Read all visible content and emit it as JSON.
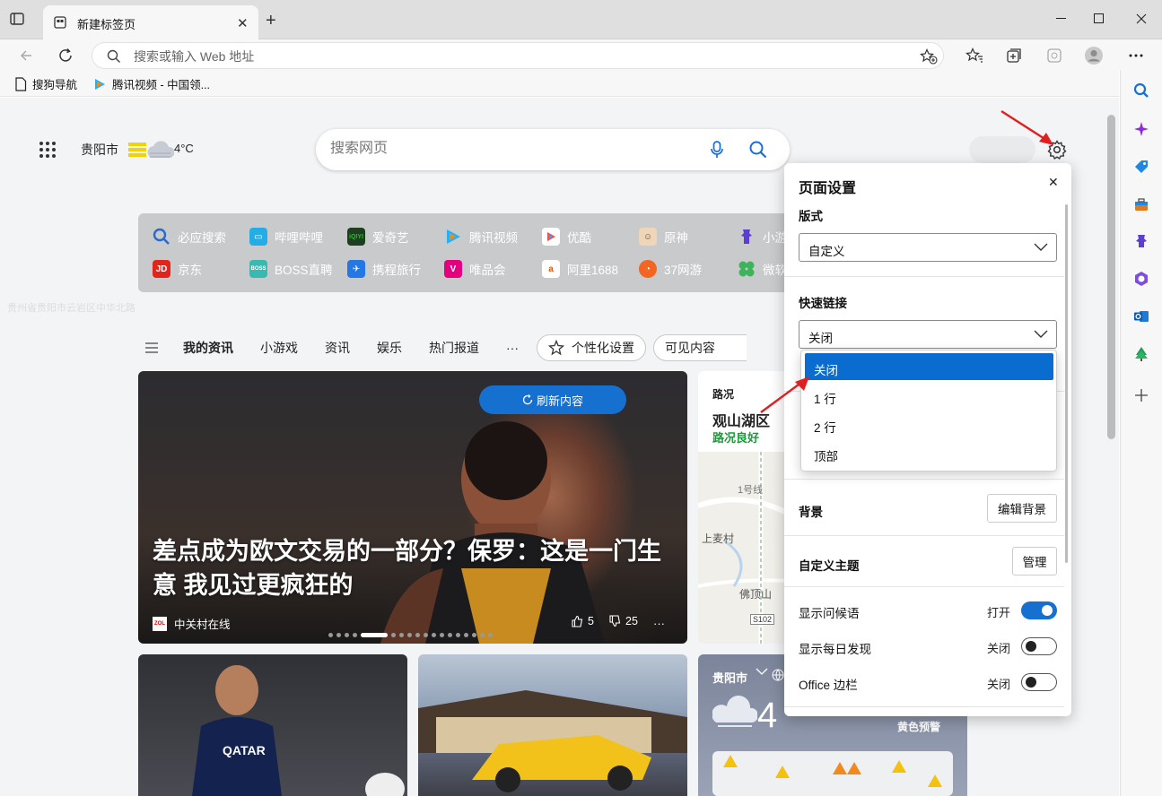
{
  "browser": {
    "tab_title": "新建标签页",
    "address_placeholder": "搜索或输入 Web 地址",
    "favorites": [
      {
        "label": "搜狗导航",
        "icon": "page-icon"
      },
      {
        "label": "腾讯视频 - 中国领...",
        "icon": "tencent-video-icon"
      }
    ]
  },
  "newtab": {
    "location": "贵阳市",
    "temperature": "4°C",
    "search_placeholder": "搜索网页",
    "faint_text": "贵州省贵阳市云岩区中华北路",
    "quick_links": [
      {
        "label": "必应搜索",
        "color": "#2a6ad0"
      },
      {
        "label": "哔哩哔哩",
        "color": "#23ade5"
      },
      {
        "label": "爱奇艺",
        "color": "#00be06"
      },
      {
        "label": "腾讯视频",
        "color": "#ff8a00"
      },
      {
        "label": "优酷",
        "color": "#1fb3f7"
      },
      {
        "label": "原神",
        "color": "#d9a36b"
      },
      {
        "label": "小游",
        "color": "#6a5acd"
      },
      {
        "label": "京东",
        "color": "#e1251b"
      },
      {
        "label": "BOSS直聘",
        "color": "#3ab9b1"
      },
      {
        "label": "携程旅行",
        "color": "#2577e3"
      },
      {
        "label": "唯品会",
        "color": "#e4007f"
      },
      {
        "label": "阿里1688",
        "color": "#ff5000"
      },
      {
        "label": "37网游",
        "color": "#f26522"
      },
      {
        "label": "微软",
        "color": "#3db35b"
      }
    ],
    "feed_tabs": [
      "我的资讯",
      "小游戏",
      "资讯",
      "娱乐",
      "热门报道",
      "···"
    ],
    "personalize_label": "个性化设置",
    "visible_content_label": "可见内容",
    "hero": {
      "refresh_label": "刷新内容",
      "title": "差点成为欧文交易的一部分？保罗：这是一门生意 我见过更疯狂的",
      "source": "中关村在线",
      "likes": "5",
      "dislikes": "25"
    },
    "traffic": {
      "label": "路况",
      "place": "观山湖区",
      "status": "路况良好",
      "map_labels": [
        "1号线",
        "上麦村",
        "佛顶山",
        "S102"
      ]
    },
    "weather_card": {
      "city": "贵阳市",
      "temp": "4",
      "alert": "黄色预警"
    }
  },
  "settings_panel": {
    "title": "页面设置",
    "layout_label": "版式",
    "layout_value": "自定义",
    "quicklinks_label": "快速链接",
    "quicklinks_value": "关闭",
    "dropdown_options": [
      "关闭",
      "1 行",
      "2 行",
      "顶部"
    ],
    "background_label": "背景",
    "edit_background": "编辑背景",
    "custom_theme_label": "自定义主题",
    "manage_label": "管理",
    "toggles": [
      {
        "label": "显示问候语",
        "state": "打开",
        "on": true
      },
      {
        "label": "显示每日发现",
        "state": "关闭",
        "on": false
      },
      {
        "label": "Office 边栏",
        "state": "关闭",
        "on": false
      }
    ]
  },
  "colors": {
    "accent": "#1570d0",
    "annotation_arrow": "#e02020"
  }
}
